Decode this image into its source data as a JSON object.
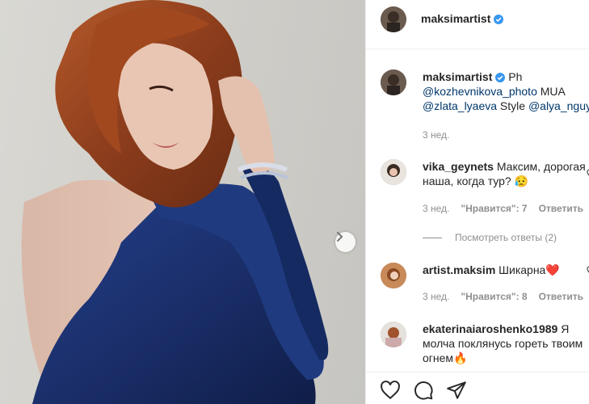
{
  "post": {
    "author": "maksimartist",
    "caption": {
      "username": "maksimartist",
      "line1": "Ph",
      "line2_mention": "@kozhevnikova_photo",
      "line2_text": " MUA",
      "line3_mention1": "@zlata_lyaeva",
      "line3_text": " Style ",
      "line3_mention2": "@alya_nguy",
      "time": "3 нед."
    }
  },
  "comments": [
    {
      "username": "vika_geynets",
      "line1": "Максим, дорогая",
      "line2": "наша, когда тур? 😥",
      "time": "3 нед.",
      "likes": "\"Нравится\": 7",
      "reply": "Ответить"
    },
    {
      "username": "artist.maksim",
      "line1": "Шикарна❤️",
      "time": "3 нед.",
      "likes": "\"Нравится\": 8",
      "reply": "Ответить"
    },
    {
      "username": "ekaterinaiaroshenko1989",
      "line1": "Я",
      "line2": "молча поклянусь гореть твоим",
      "line3": "огнем🔥"
    }
  ],
  "view_replies": "Посмотреть ответы (2)",
  "colors": {
    "verified": "#3897f0",
    "link": "#00376b",
    "meta": "#8e8e8e",
    "dress": "#1b2f6b"
  },
  "icons": [
    "verified-badge-icon",
    "heart-icon",
    "comment-icon",
    "share-icon",
    "chevron-right-icon"
  ]
}
